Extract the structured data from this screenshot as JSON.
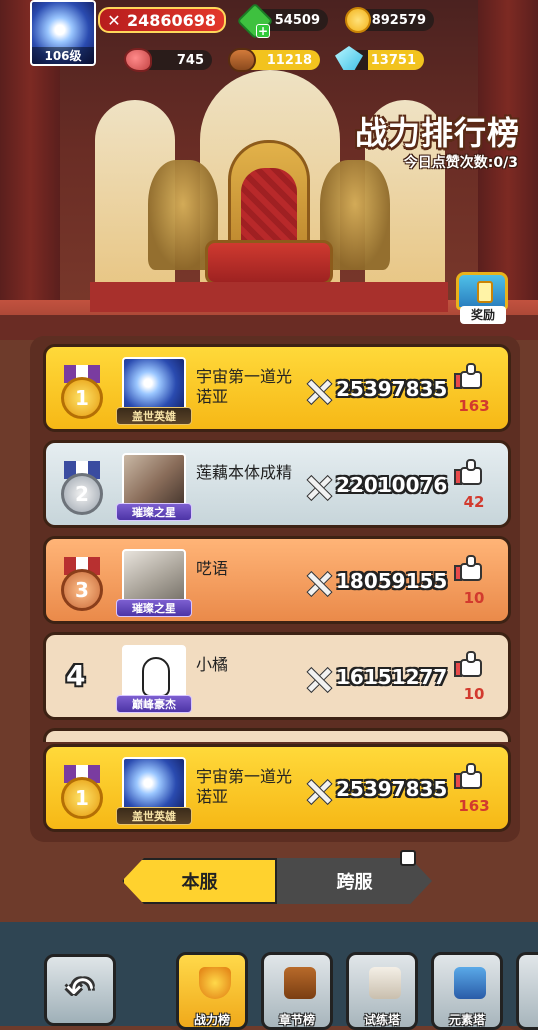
{
  "player": {
    "level": "106级",
    "power": "24860698",
    "gems": "54509",
    "gold": "892579",
    "meat": "745",
    "wood": "11218",
    "crystal": "13751"
  },
  "header": {
    "title": "战力排行榜",
    "likes_today": "今日点赞次数:0/3",
    "reward_label": "奖励"
  },
  "ranking": [
    {
      "rank": "1",
      "name": "宇宙第一道光诺亚",
      "badge": "盖世英雄",
      "power": "25397835",
      "likes": "163"
    },
    {
      "rank": "2",
      "name": "莲藕本体成精",
      "badge": "璀璨之星",
      "power": "22010076",
      "likes": "42"
    },
    {
      "rank": "3",
      "name": "呓语",
      "badge": "璀璨之星",
      "power": "18059155",
      "likes": "10"
    },
    {
      "rank": "4",
      "name": "小橘",
      "badge": "巅峰豪杰",
      "power": "16151277",
      "likes": "10"
    }
  ],
  "my_rank": {
    "rank": "1",
    "name": "宇宙第一道光诺亚",
    "badge": "盖世英雄",
    "power": "25397835",
    "likes": "163"
  },
  "tabs": {
    "local": "本服",
    "cross": "跨服"
  },
  "nav": {
    "items": [
      {
        "label": "战力榜"
      },
      {
        "label": "章节榜"
      },
      {
        "label": "试练塔"
      },
      {
        "label": "元素塔"
      }
    ]
  },
  "colors": {
    "gold_row": "#ffd93a",
    "silver_row": "#dfe8ec",
    "bronze_row": "#f39a5a",
    "plain_row": "#f2dcc0",
    "likes_red": "#d23a2e"
  }
}
